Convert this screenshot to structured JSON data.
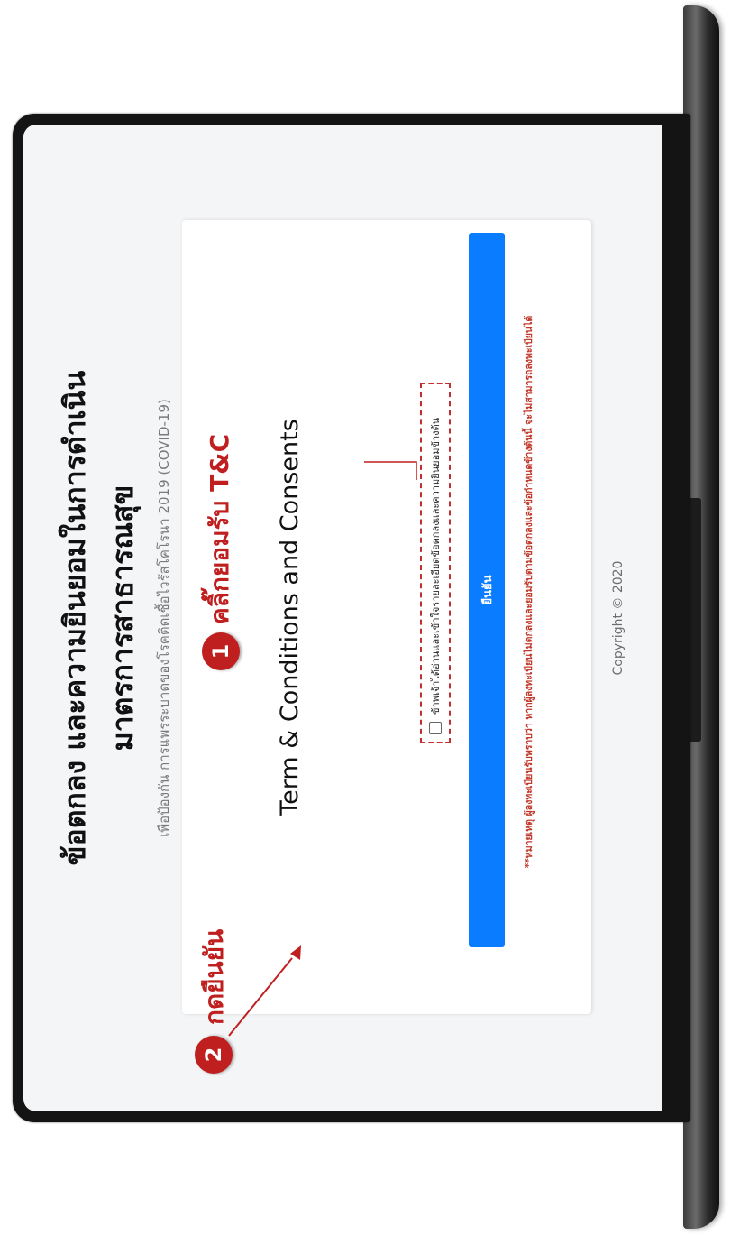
{
  "page": {
    "title_line1": "ข้อตกลง และความยินยอมในการดำเนิน",
    "title_line2": "มาตรการสาธารณสุข",
    "subtitle": "เพื่อป้องกัน การแพร่ระบาดของโรคติดเชื้อไวรัสโคโรนา 2019 (COVID-19)"
  },
  "card": {
    "heading": "Term & Conditions and Consents",
    "consent_label": "ข้าพเจ้าได้อ่านและเข้าใจรายละเอียดข้อตกลงและความยินยอมข้างต้น",
    "checkbox_checked": false,
    "confirm_button": "ยืนยัน",
    "warning_note": "**หมายเหตุ ผู้ลงทะเบียนรับทราบว่า หากผู้ลงทะเบียนไม่ตกลงและยอมรับตามข้อตกลงและข้อกำหนดข้างต้นนี้ จะไม่สามารถลงทะเบียนได้"
  },
  "footer": {
    "copyright": "Copyright © 2020"
  },
  "annotations": {
    "step1_number": "1",
    "step1_text": "คลิ๊กยอมรับ T&C",
    "step2_number": "2",
    "step2_text": "กดยืนยัน"
  },
  "colors": {
    "accent": "#0a7cff",
    "annotation_red": "#c01f1f",
    "warning_red": "#c0392b",
    "screen_bg": "#f4f5f7"
  }
}
